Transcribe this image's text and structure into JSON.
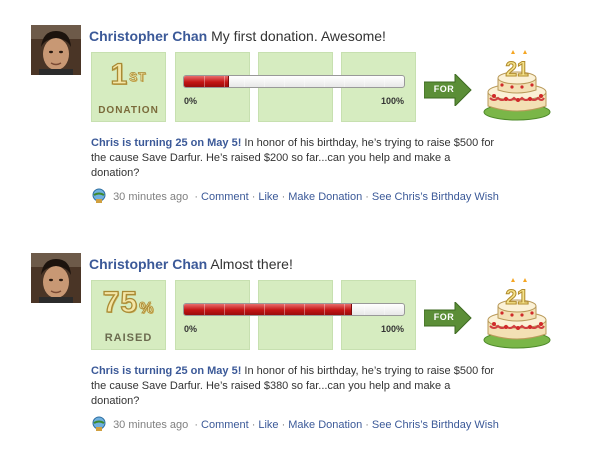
{
  "colors": {
    "link": "#3b5998",
    "stage_green": "#d6ecc0",
    "bar_red": "#c41414",
    "arrow_green": "#5b8e37"
  },
  "posts": [
    {
      "author": "Christopher Chan",
      "message": "My first donation. Awesome!",
      "badge": {
        "main": "1",
        "suffix": "ST",
        "label": "DONATION"
      },
      "progress": {
        "percent_filled": 20,
        "min_label": "0%",
        "max_label": "100%"
      },
      "arrow_label": "FOR",
      "cake_number": "21",
      "description_highlight": "Chris is turning 25 on May 5!",
      "description_text": " In honor of his birthday, he’s trying to raise $500 for the cause Save Darfur. He’s raised $200 so far...can you help and make a donation?",
      "timestamp": "30 minutes ago",
      "actions": [
        "Comment",
        "Like",
        "Make Donation",
        "See Chris’s Birthday Wish"
      ],
      "app_icon": "donation-app-icon"
    },
    {
      "author": "Christopher Chan",
      "message": "Almost there!",
      "badge": {
        "main": "75",
        "suffix": "%",
        "label": "RAISED"
      },
      "progress": {
        "percent_filled": 76,
        "min_label": "0%",
        "max_label": "100%"
      },
      "arrow_label": "FOR",
      "cake_number": "21",
      "description_highlight": "Chris is turning 25 on May 5!",
      "description_text": " In honor of his birthday, he’s trying to raise $500 for the cause Save Darfur. He’s raised $380 so far...can you help and make a donation?",
      "timestamp": "30 minutes ago",
      "actions": [
        "Comment",
        "Like",
        "Make Donation",
        "See Chris’s Birthday Wish"
      ],
      "app_icon": "donation-app-icon"
    }
  ]
}
